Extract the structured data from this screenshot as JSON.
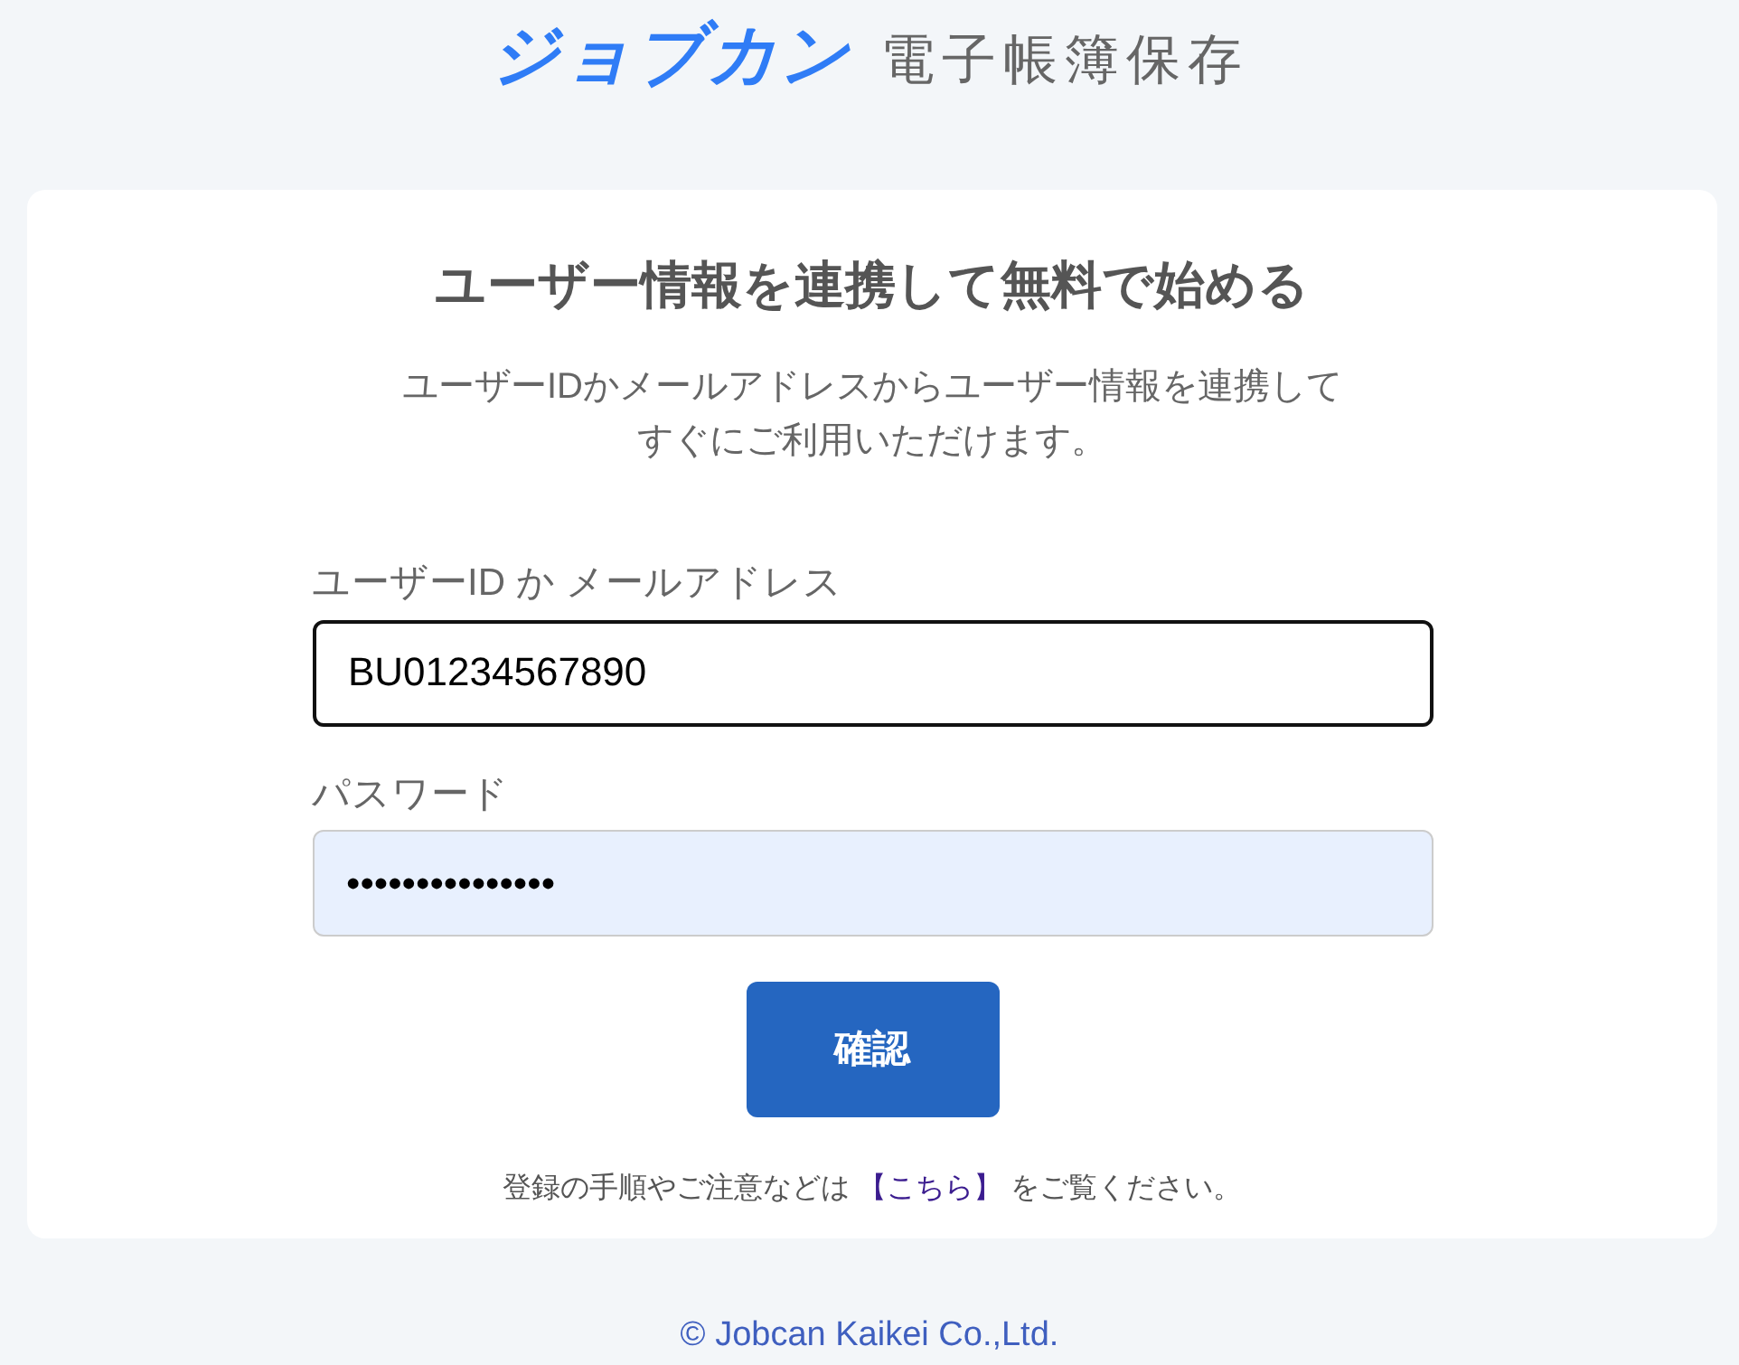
{
  "logo": {
    "brand": "ジョブカン",
    "product": "電子帳簿保存"
  },
  "card": {
    "title": "ユーザー情報を連携して無料で始める",
    "description": [
      "ユーザーIDかメールアドレスからユーザー情報を連携して",
      "すぐにご利用いただけます。"
    ],
    "fields": [
      {
        "label": "ユーザーID か メールアドレス",
        "value": "BU01234567890",
        "focused": true,
        "autofilled": false
      },
      {
        "label": "パスワード",
        "value": "•••••••••••••••",
        "focused": false,
        "autofilled": true
      }
    ],
    "button": "確認",
    "note": {
      "before": "登録の手順やご注意などは ",
      "link": "【こちら】",
      "after": " をご覧ください。"
    }
  },
  "footer": "© Jobcan Kaikei Co.,Ltd."
}
